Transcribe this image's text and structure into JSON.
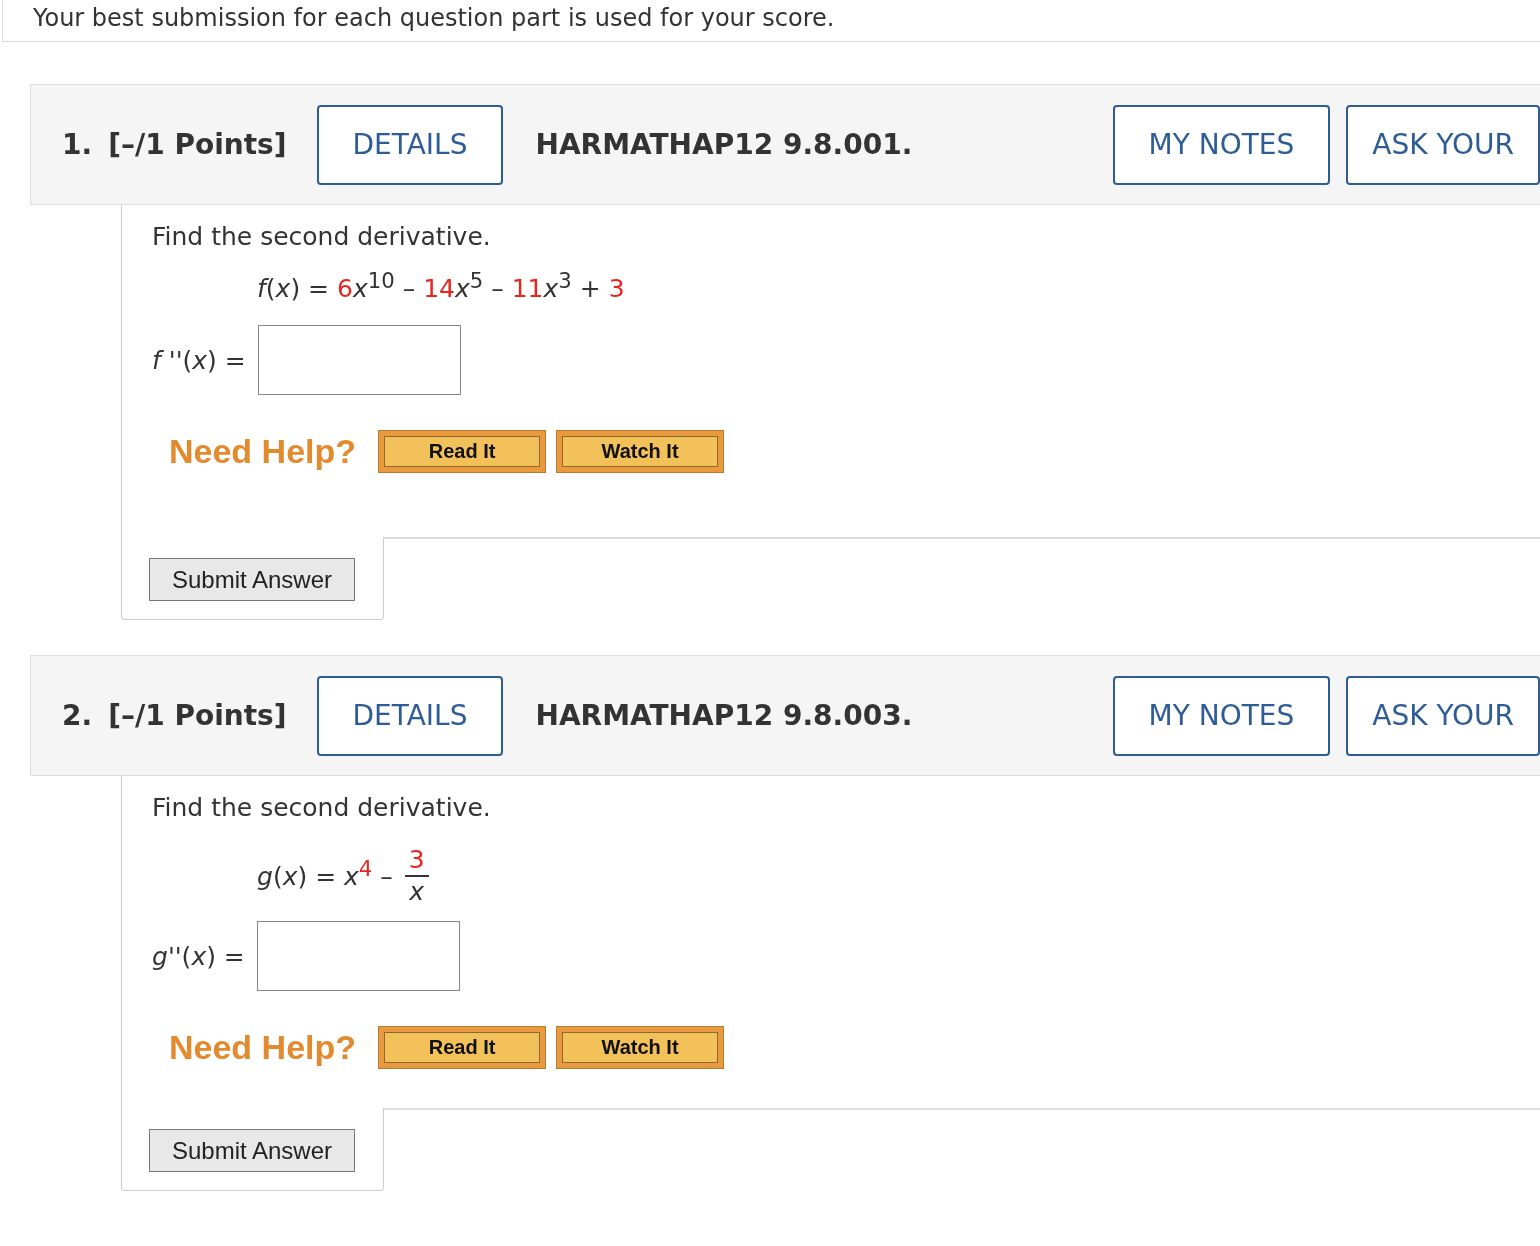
{
  "notice": "Your best submission for each question part is used for your score.",
  "questions": [
    {
      "number": "1.",
      "points": "[–/1 Points]",
      "details_button": "DETAILS",
      "title": "HARMATHAP12 9.8.001.",
      "notes_button": "MY NOTES",
      "ask_button": "ASK YOUR",
      "prompt": "Find the second derivative.",
      "formula": [
        {
          "kind": "text",
          "text": "*f*(*x*) = ",
          "given": false
        },
        {
          "kind": "text",
          "text": "6",
          "given": true
        },
        {
          "kind": "text",
          "text": "*x*$^{10}$ – ",
          "given": false
        },
        {
          "kind": "text",
          "text": "14",
          "given": true
        },
        {
          "kind": "text",
          "text": "*x*$^{5}$ – ",
          "given": false
        },
        {
          "kind": "text",
          "text": "11",
          "given": true
        },
        {
          "kind": "text",
          "text": "*x*$^{3}$ + ",
          "given": false
        },
        {
          "kind": "text",
          "text": "3",
          "given": true
        }
      ],
      "answer_label": "*f* ''(*x*) =",
      "help_label": "Need Help?",
      "help_buttons": [
        "Read It",
        "Watch It"
      ],
      "submit_button": "Submit Answer"
    },
    {
      "number": "2.",
      "points": "[–/1 Points]",
      "details_button": "DETAILS",
      "title": "HARMATHAP12 9.8.003.",
      "notes_button": "MY NOTES",
      "ask_button": "ASK YOUR",
      "prompt": "Find the second derivative.",
      "formula": [
        {
          "kind": "text",
          "text": "*g*(*x*) = *x*",
          "given": false
        },
        {
          "kind": "text",
          "text": "$^{4}$",
          "given": true
        },
        {
          "kind": "text",
          "text": " – ",
          "given": false
        },
        {
          "kind": "fraction",
          "numerator": {
            "text": "3",
            "given": true
          },
          "denominator": {
            "text": "*x*",
            "given": false
          }
        }
      ],
      "answer_label": "*g*''(*x*) =",
      "help_label": "Need Help?",
      "help_buttons": [
        "Read It",
        "Watch It"
      ],
      "submit_button": "Submit Answer"
    }
  ]
}
